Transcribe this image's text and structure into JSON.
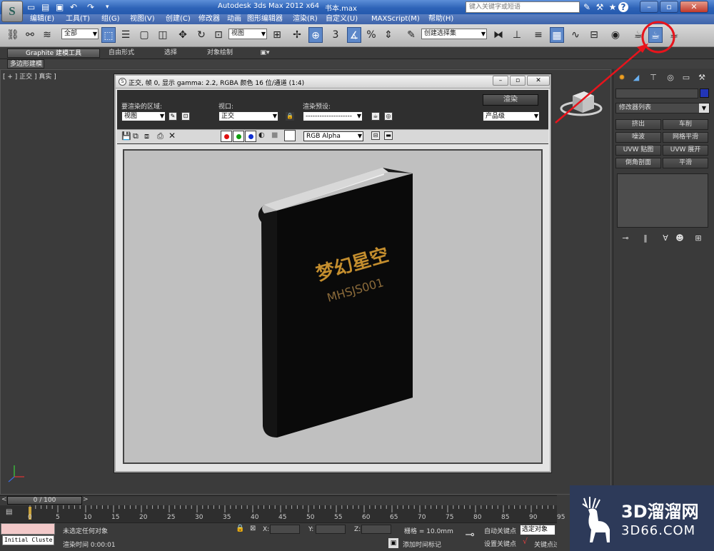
{
  "titlebar": {
    "app_logo": "S",
    "title": "Autodesk 3ds Max  2012 x64",
    "file": "书本.max",
    "search_placeholder": "键入关键字或短语",
    "help": "?"
  },
  "menu": [
    "编辑(E)",
    "工具(T)",
    "组(G)",
    "视图(V)",
    "创建(C)",
    "修改器",
    "动画",
    "图形编辑器",
    "渲染(R)",
    "自定义(U)",
    "MAXScript(M)",
    "帮助(H)"
  ],
  "toolbar": {
    "selection_filter": "全部",
    "ref_coord": "视图",
    "named_selection": "创建选择集",
    "snap_label": "3"
  },
  "ribbon": {
    "tabs": [
      "Graphite 建模工具",
      "自由形式",
      "选择",
      "对象绘制"
    ],
    "subtab": "多边形建模"
  },
  "viewport": {
    "label": "[ + ] 正交 ] 真实 ]"
  },
  "render_window": {
    "title": "正交, 帧 0, 显示 gamma: 2.2, RGBA 颜色 16 位/通道 (1:4)",
    "area_label": "要渲染的区域:",
    "area_value": "视图",
    "viewport_label": "视口:",
    "viewport_value": "正交",
    "preset_label": "渲染预设:",
    "preset_value": "--------------------",
    "render_button": "渲染",
    "quality_value": "产品级",
    "channel_value": "RGB Alpha",
    "book_title": "梦幻星空",
    "book_code": "MHSJS001"
  },
  "command_panel": {
    "modifier_list": "修改器列表",
    "buttons": [
      "挤出",
      "车削",
      "噪波",
      "网格平滑",
      "UVW 贴图",
      "UVW 展开",
      "倒角剖面",
      "平滑"
    ]
  },
  "timeline": {
    "slider": "0 / 100",
    "ticks": [
      "0",
      "5",
      "10",
      "15",
      "20",
      "25",
      "30",
      "35",
      "40",
      "45",
      "50",
      "55",
      "60",
      "65",
      "70",
      "75",
      "80",
      "85",
      "90",
      "95"
    ]
  },
  "status": {
    "listener": "Initial Cluste",
    "selection": "未选定任何对象",
    "render_time": "渲染时间  0:00:01",
    "x_label": "X:",
    "y_label": "Y:",
    "z_label": "Z:",
    "grid": "栅格 = 10.0mm",
    "add_time_tag": "添加时间标记",
    "auto_key": "自动关键点",
    "set_key": "设置关键点",
    "selected_object": "选定对象",
    "key_filters": "关键点过滤"
  },
  "watermark": {
    "brand": "3D溜溜网",
    "domain": "3D66.COM"
  },
  "colors": {
    "title_blue": "#2f64b8",
    "annotation_red": "#e8141c",
    "panel_dark": "#3a3a3a"
  }
}
